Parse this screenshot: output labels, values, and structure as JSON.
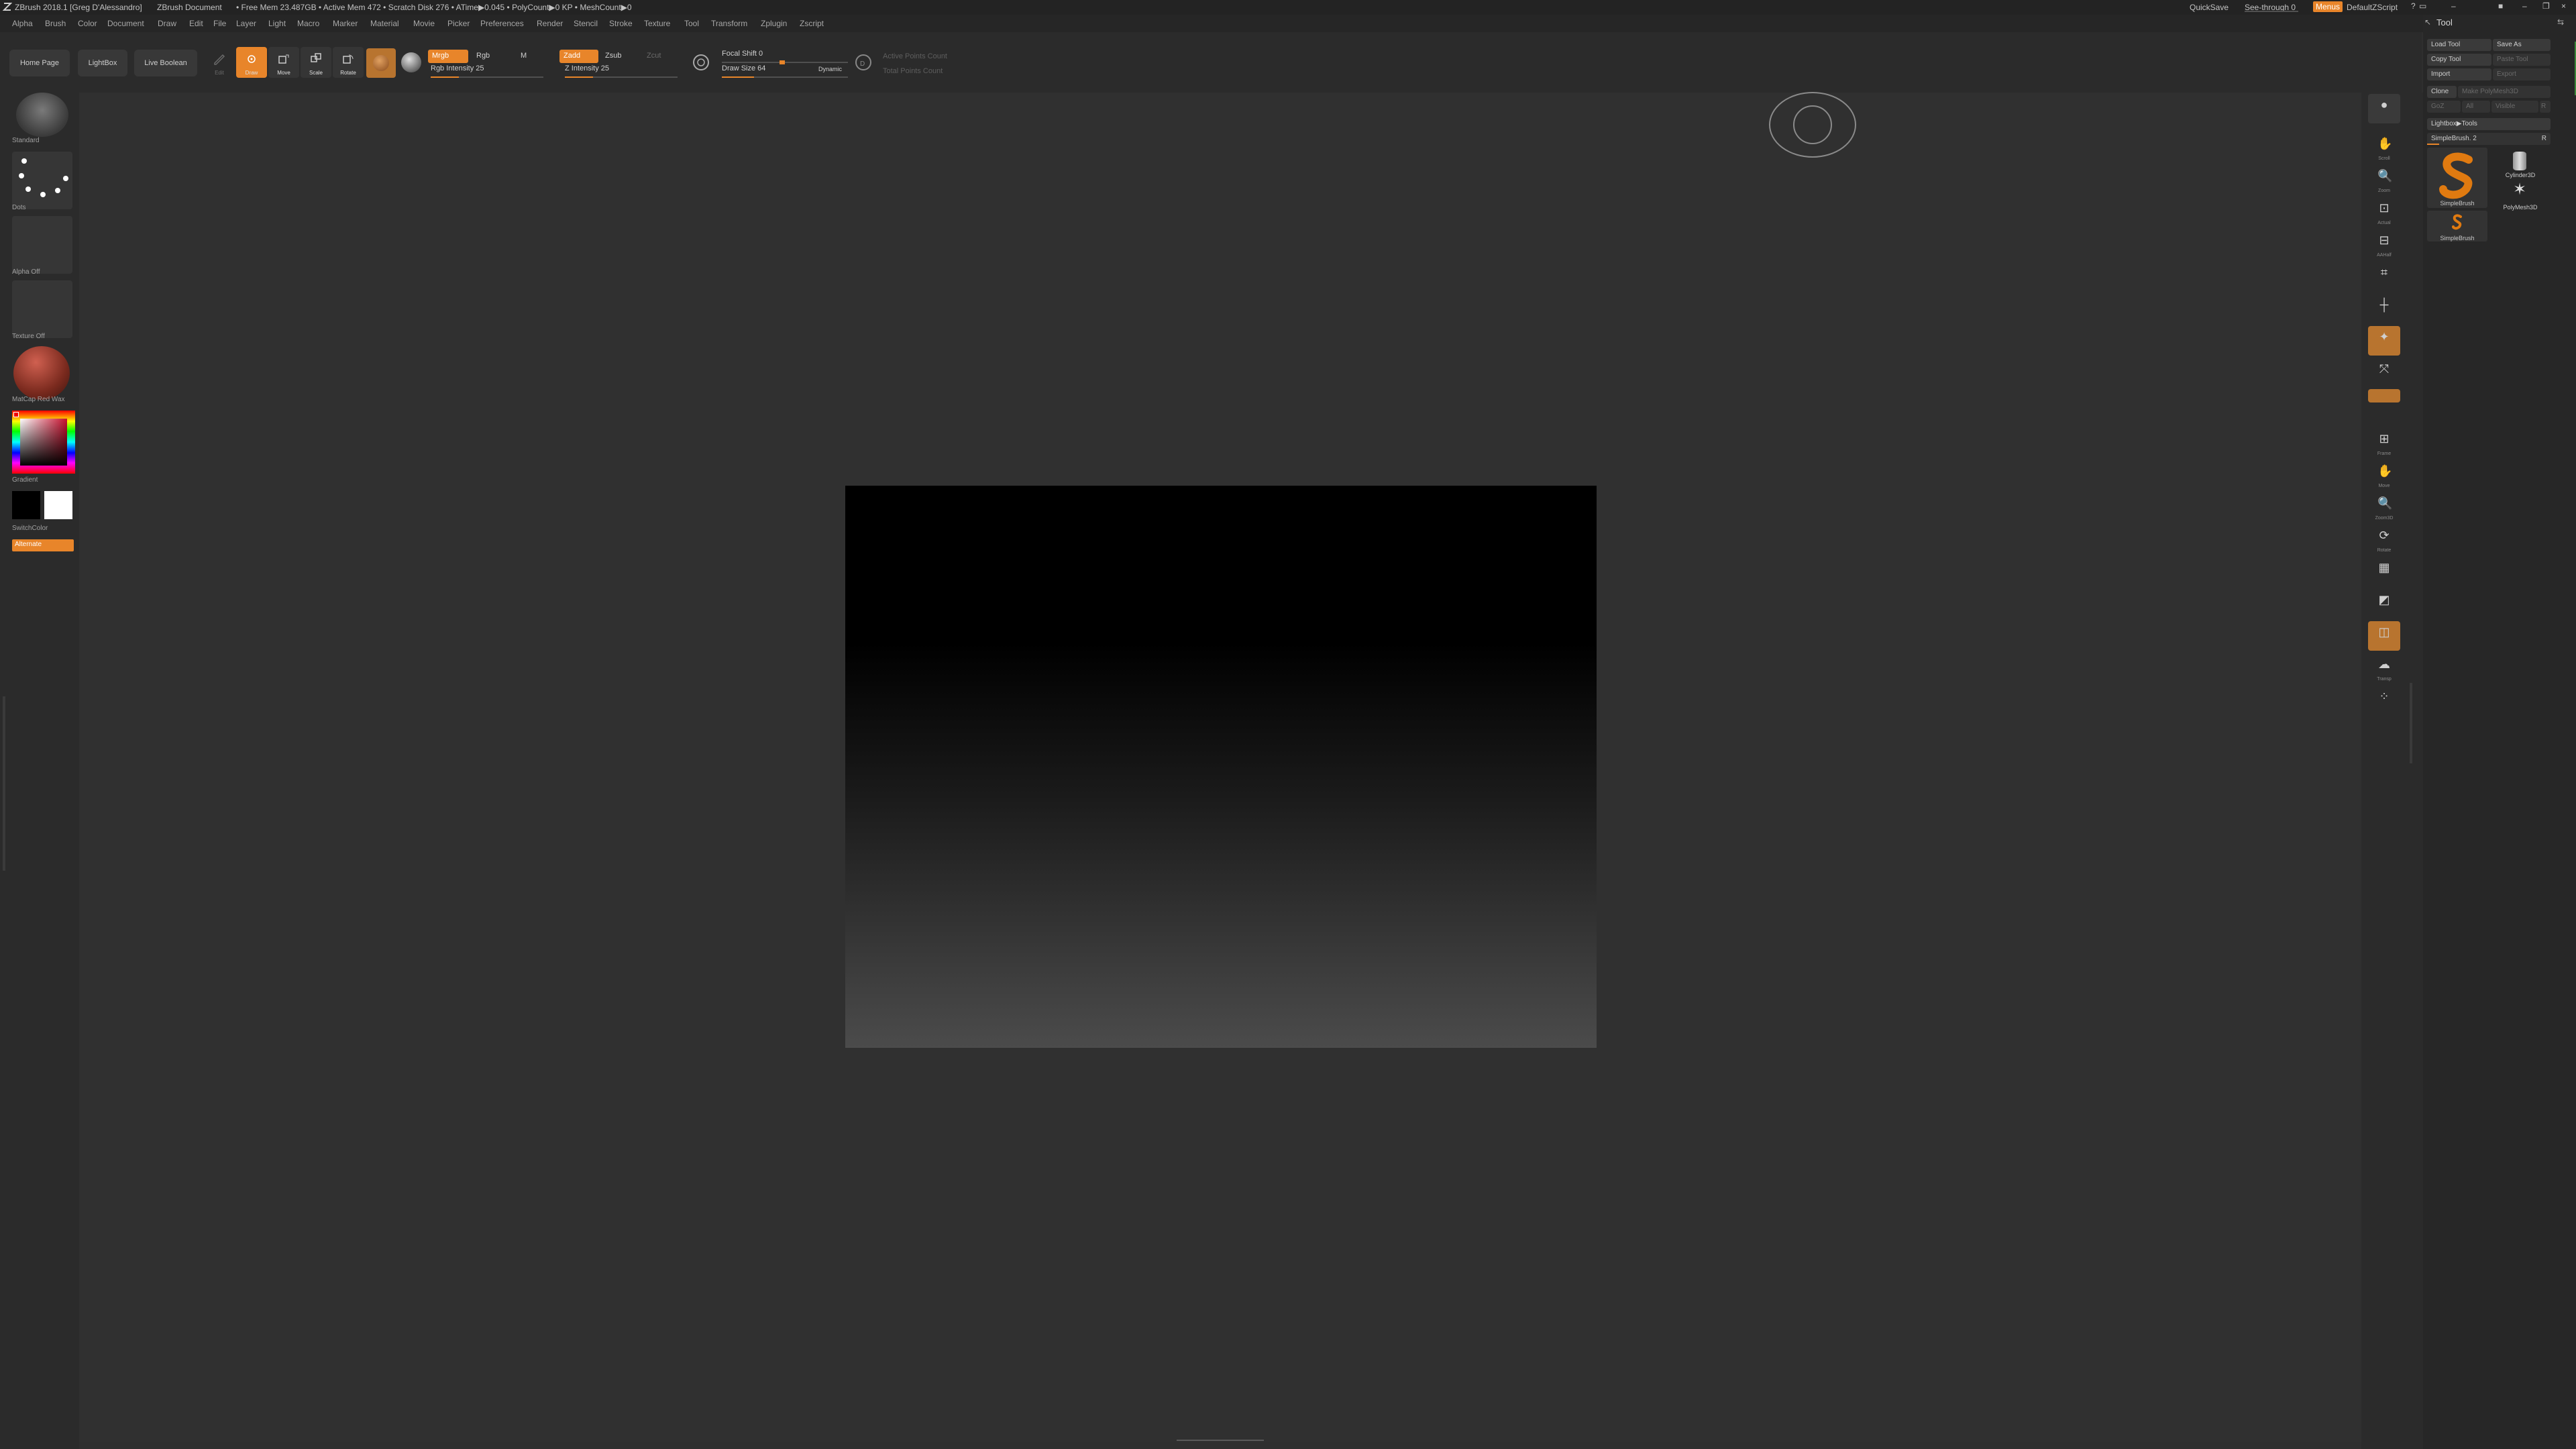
{
  "titlebar": {
    "app_title": "ZBrush 2018.1 [Greg D'Alessandro]",
    "document": "ZBrush Document",
    "stats": "• Free Mem 23.487GB • Active Mem 472 • Scratch Disk 276 • ATime▶0.045 • PolyCount▶0 KP • MeshCount▶0",
    "quicksave": "QuickSave",
    "see_through": "See-through 0",
    "menus": "Menus",
    "default_script": "DefaultZScript"
  },
  "menubar": [
    "Alpha",
    "Brush",
    "Color",
    "Document",
    "Draw",
    "Edit",
    "File",
    "Layer",
    "Light",
    "Macro",
    "Marker",
    "Material",
    "Movie",
    "Picker",
    "Preferences",
    "Render",
    "Stencil",
    "Stroke",
    "Texture",
    "Tool",
    "Transform",
    "Zplugin",
    "Zscript"
  ],
  "toolbar": {
    "home_page": "Home Page",
    "lightbox": "LightBox",
    "live_boolean": "Live Boolean",
    "edit": "Edit",
    "draw": "Draw",
    "move": "Move",
    "scale": "Scale",
    "rotate": "Rotate",
    "mrgb": "Mrgb",
    "rgb": "Rgb",
    "m": "M",
    "rgb_intensity": "Rgb Intensity 25",
    "rgb_intensity_value": 25,
    "zadd": "Zadd",
    "zsub": "Zsub",
    "zcut": "Zcut",
    "z_intensity": "Z Intensity 25",
    "z_intensity_value": 25,
    "focal_shift": "Focal Shift 0",
    "focal_shift_value": 0,
    "draw_size": "Draw Size 64",
    "draw_size_value": 64,
    "dynamic": "Dynamic",
    "active_points": "Active Points Count",
    "total_points": "Total Points Count"
  },
  "leftshelf": {
    "brush_label": "Standard",
    "stroke_label": "Dots",
    "alpha_label": "Alpha Off",
    "texture_label": "Texture Off",
    "material_label": "MatCap Red Wax",
    "gradient_label": "Gradient",
    "switchcolor_label": "SwitchColor",
    "alternate_label": "Alternate"
  },
  "rightshelf": [
    "",
    "Scroll",
    "Zoom",
    "Actual",
    "AAHalf",
    "",
    "",
    "",
    "",
    "",
    "Frame",
    "Move",
    "Zoom3D",
    "Rotate",
    "",
    "",
    "",
    "Transp",
    "",
    ""
  ],
  "toolpanel": {
    "title": "Tool",
    "load_tool": "Load Tool",
    "save_as": "Save As",
    "copy_tool": "Copy Tool",
    "paste_tool": "Paste Tool",
    "import": "Import",
    "export": "Export",
    "clone": "Clone",
    "make_polymesh": "Make PolyMesh3D",
    "goz": "GoZ",
    "all": "All",
    "visible": "Visible",
    "r": "R",
    "lightbox_tools": "Lightbox▶Tools",
    "current_tool": "SimpleBrush. 2",
    "current_tool_count": "R",
    "tools": [
      {
        "name": "SimpleBrush"
      },
      {
        "name": "Cylinder3D"
      },
      {
        "name": "PolyMesh3D"
      },
      {
        "name": "SimpleBrush"
      }
    ]
  },
  "colors": {
    "accent": "#e8852a",
    "background": "#303030",
    "panel": "#2b2b2b"
  }
}
